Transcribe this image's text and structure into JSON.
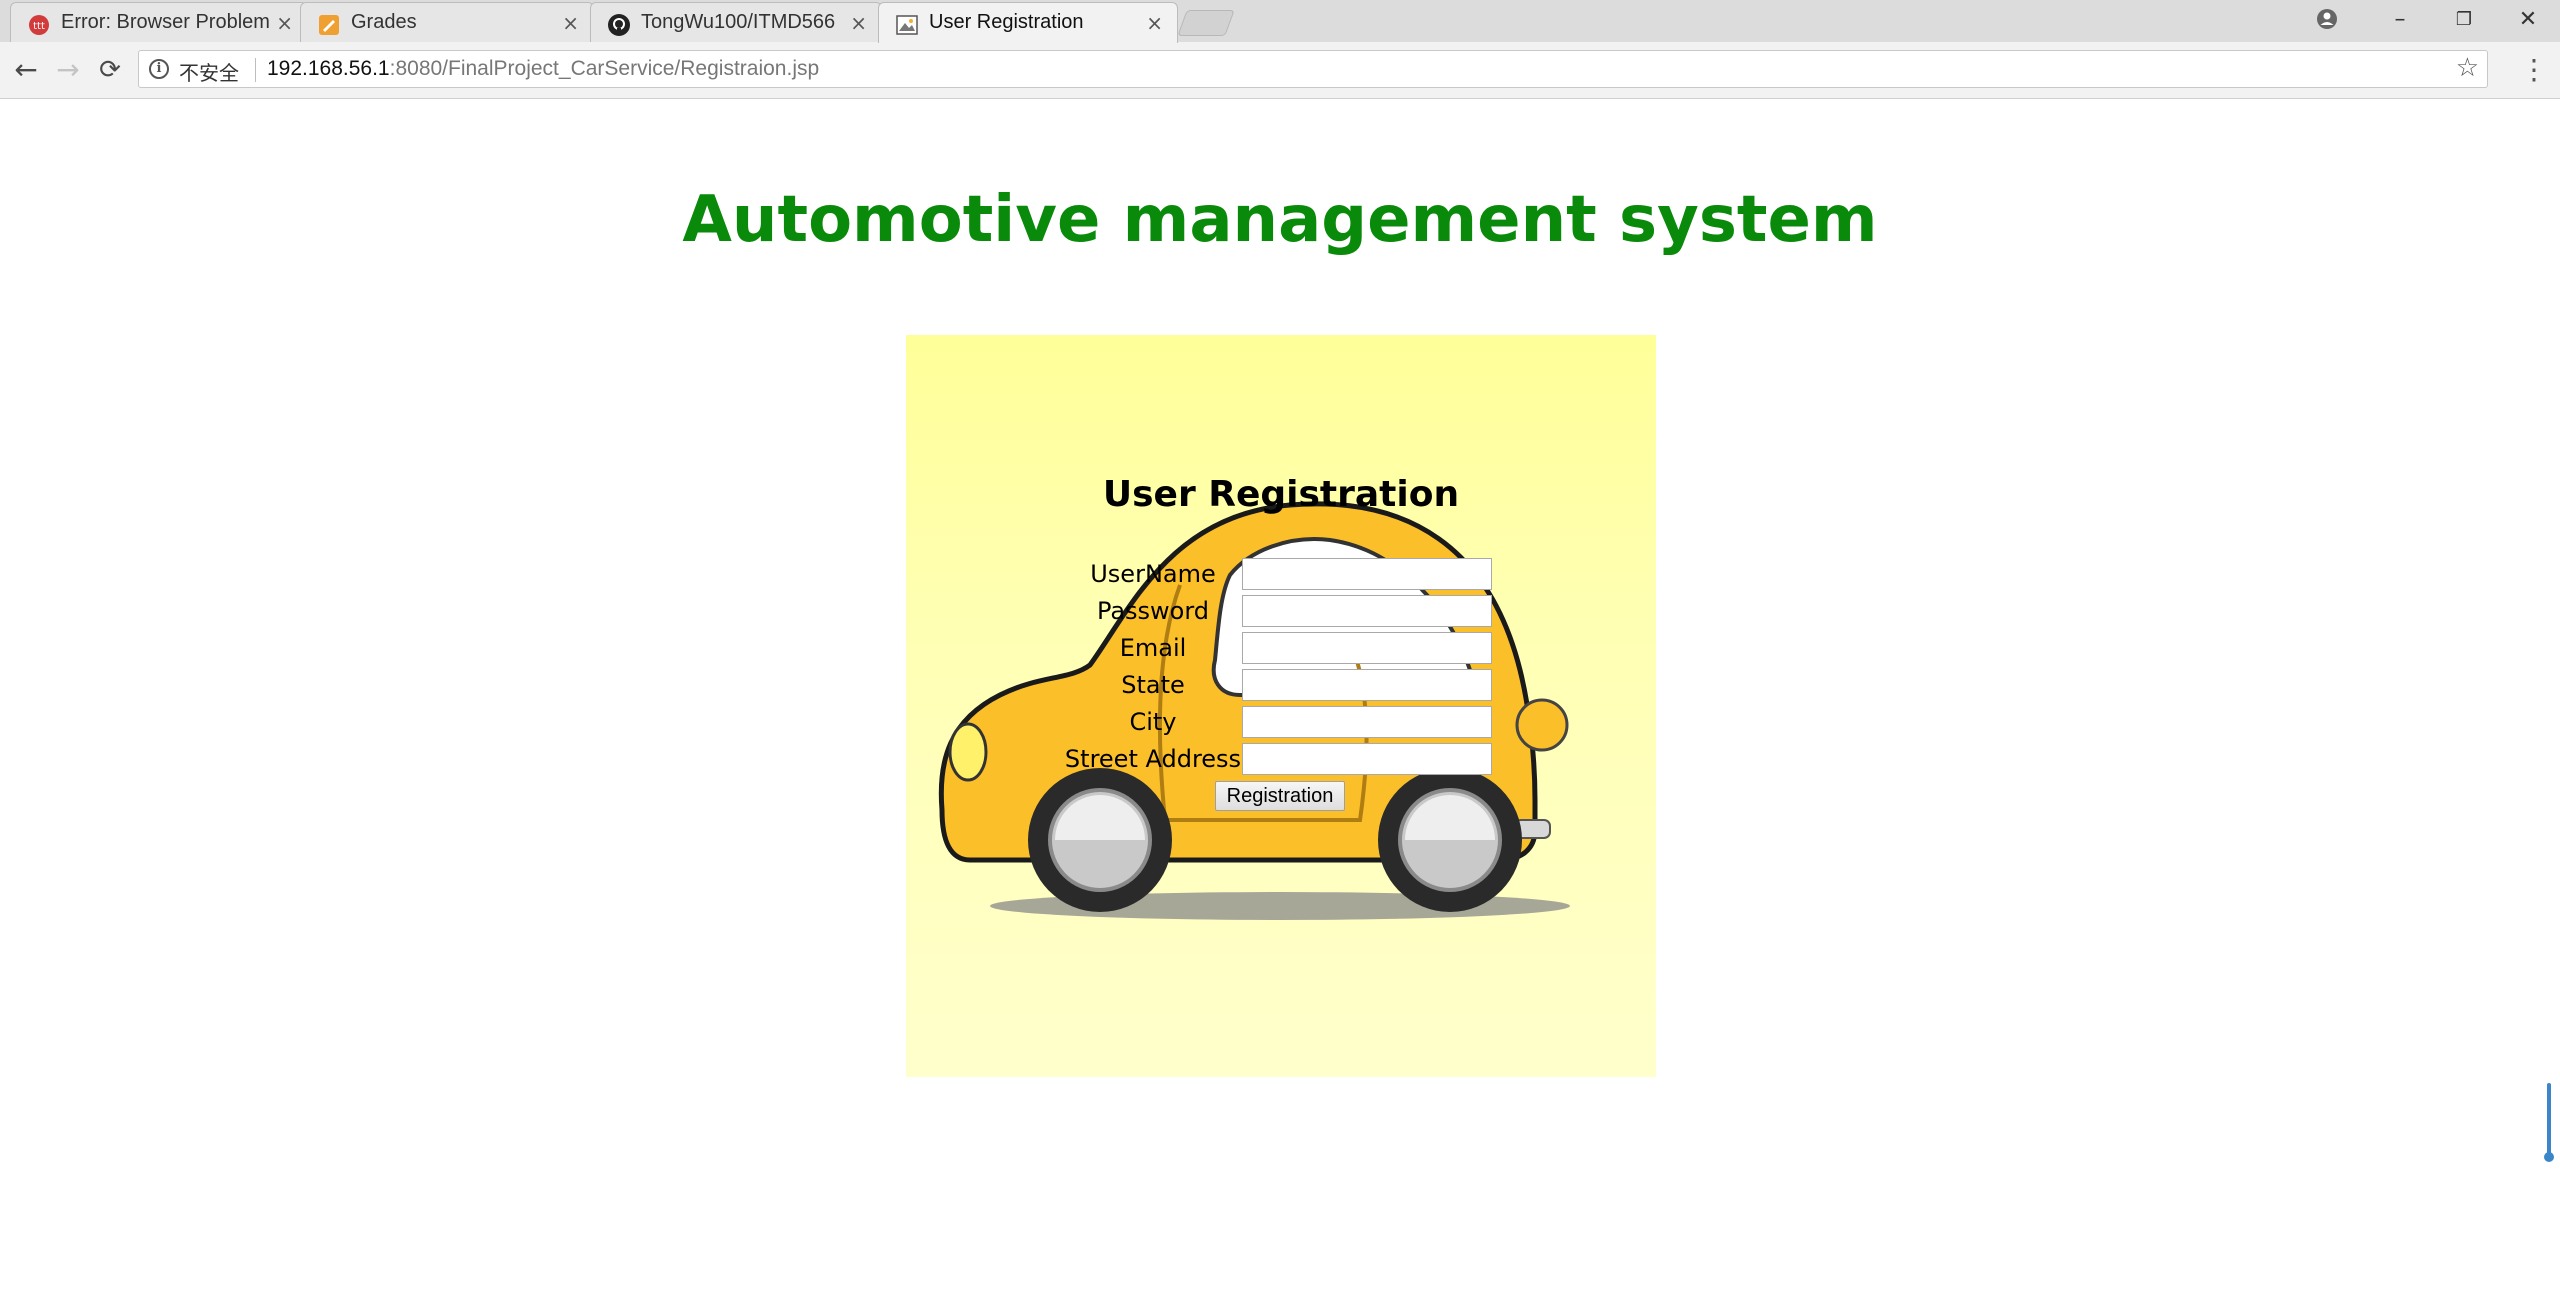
{
  "browser": {
    "tabs": [
      {
        "title": "Error: Browser Problem",
        "icon": "error-favicon",
        "active": false
      },
      {
        "title": "Grades",
        "icon": "grades-favicon",
        "active": false
      },
      {
        "title": "TongWu100/ITMD566",
        "icon": "github-favicon",
        "active": false
      },
      {
        "title": "User Registration",
        "icon": "image-favicon",
        "active": true
      }
    ],
    "tab_close_glyph": "×",
    "window_controls": {
      "account": "account-icon",
      "minimize": "–",
      "restore": "❐",
      "close": "✕"
    },
    "toolbar": {
      "back": "←",
      "forward": "→",
      "reload": "⟳",
      "security_label": "不安全",
      "url_host": "192.168.56.1",
      "url_rest": ":8080/FinalProject_CarService/Registraion.jsp",
      "bookmark": "☆",
      "menu": "⋮"
    }
  },
  "page": {
    "heading": "Automotive management system",
    "heading_color": "#0a8a0a",
    "form": {
      "title": "User Registration",
      "fields": [
        {
          "label": "UserName",
          "value": ""
        },
        {
          "label": "Password",
          "value": ""
        },
        {
          "label": "Email",
          "value": ""
        },
        {
          "label": "State",
          "value": ""
        },
        {
          "label": "City",
          "value": ""
        },
        {
          "label": "Street Address",
          "value": ""
        }
      ],
      "submit_label": "Registration"
    },
    "background_image": "yellow-cartoon-car"
  }
}
